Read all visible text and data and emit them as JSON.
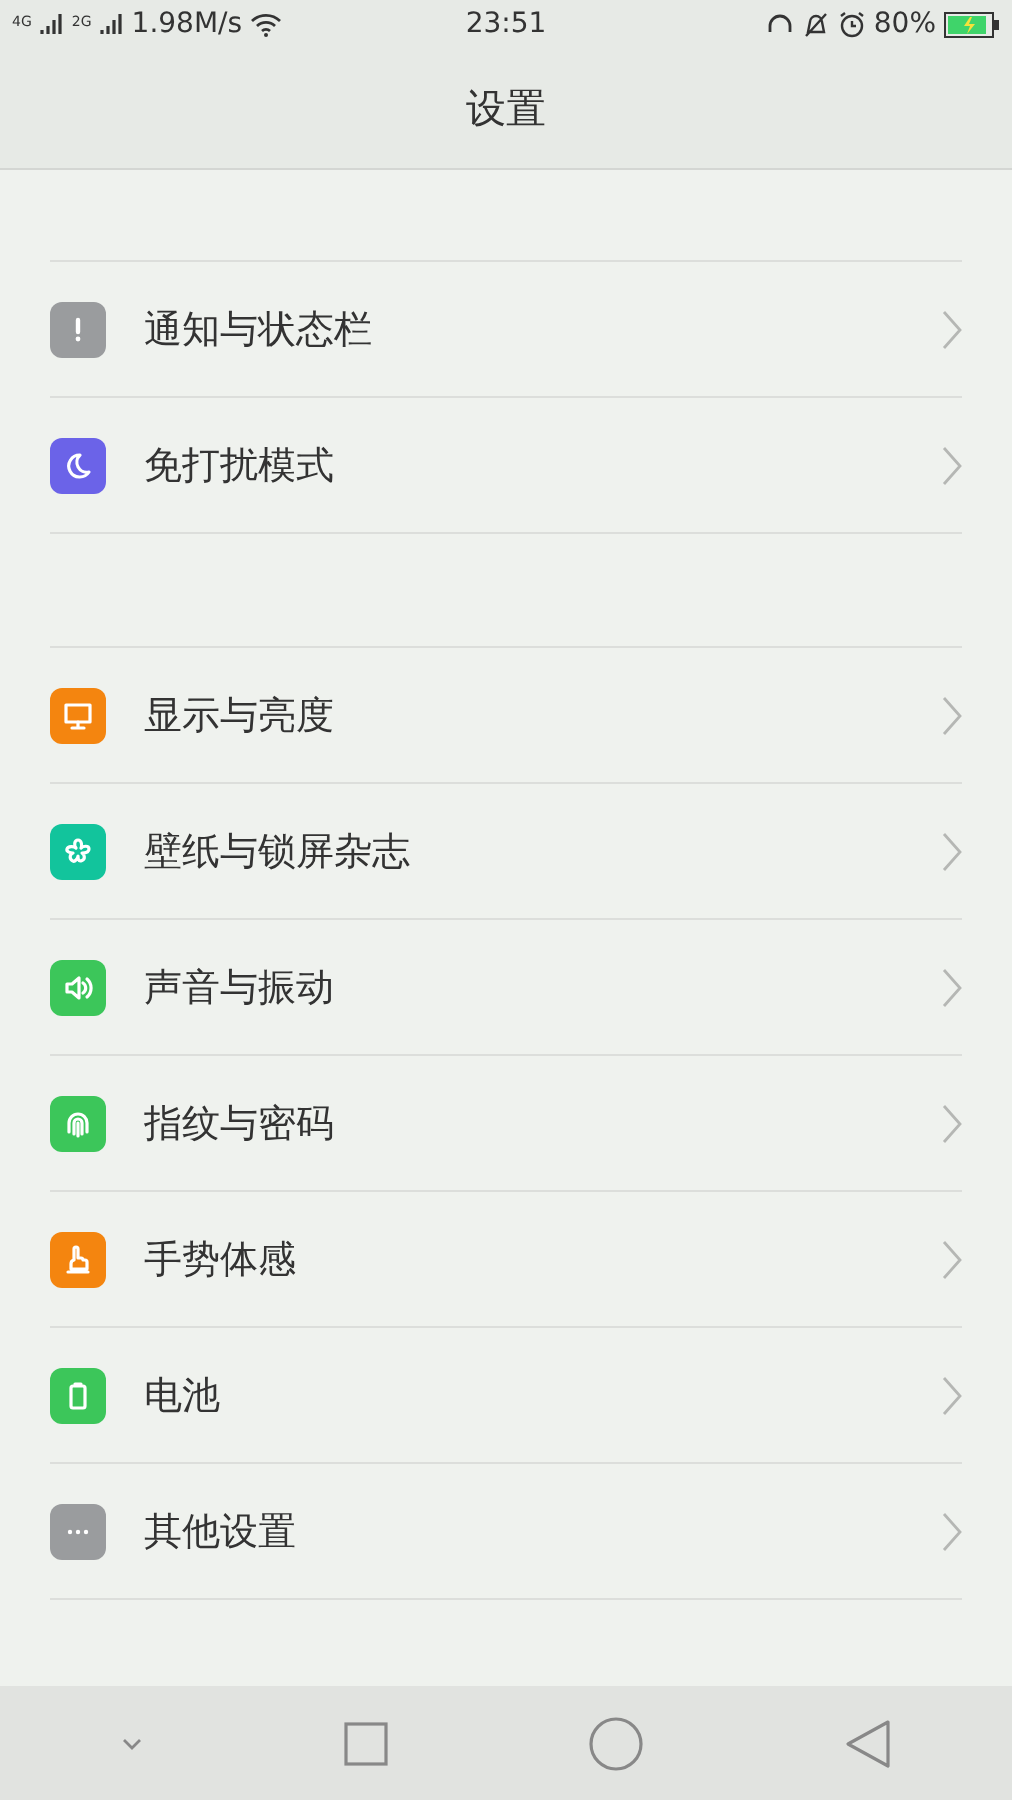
{
  "status_bar": {
    "sim_1": "4G",
    "sim_2": "2G",
    "speed": "1.98M/s",
    "time": "23:51",
    "battery": "80%"
  },
  "title": "设置",
  "sections": [
    {
      "items": [
        {
          "label": "通知与状态栏",
          "color": "#9a9c9e"
        },
        {
          "label": "免打扰模式",
          "color": "#6b63e8"
        }
      ]
    },
    {
      "items": [
        {
          "label": "显示与亮度",
          "color": "#f4850f"
        },
        {
          "label": "壁纸与锁屏杂志",
          "color": "#12c49c"
        },
        {
          "label": "声音与振动",
          "color": "#3cc65a"
        },
        {
          "label": "指纹与密码",
          "color": "#3cc65a"
        },
        {
          "label": "手势体感",
          "color": "#f4850f"
        },
        {
          "label": "电池",
          "color": "#3cc65a"
        },
        {
          "label": "其他设置",
          "color": "#9a9c9e"
        }
      ]
    }
  ]
}
